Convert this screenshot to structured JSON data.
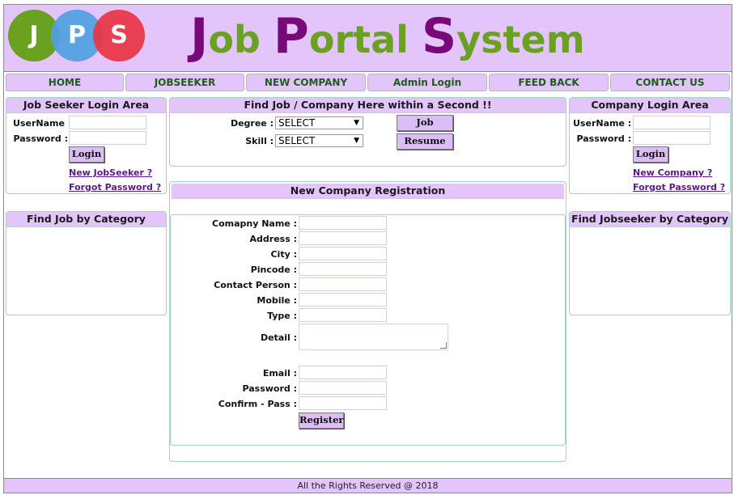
{
  "header": {
    "logo_letters": [
      "J",
      "P",
      "S"
    ],
    "title_parts": [
      {
        "text": "J",
        "size": "big"
      },
      {
        "text": "ob ",
        "size": "small"
      },
      {
        "text": "P",
        "size": "big"
      },
      {
        "text": "ortal ",
        "size": "small"
      },
      {
        "text": "S",
        "size": "big"
      },
      {
        "text": "ystem",
        "size": "small"
      }
    ]
  },
  "nav": {
    "items": [
      "HOME",
      "JOBSEEKER",
      "NEW COMPANY",
      "Admin Login",
      "FEED BACK",
      "CONTACT US"
    ]
  },
  "jobseeker_login": {
    "title": "Job Seeker Login Area",
    "username_label": "UserName :",
    "password_label": "Password :",
    "login_button": "Login",
    "new_link": "New JobSeeker ?",
    "forgot_link": "Forgot Password ?"
  },
  "find_job_category": {
    "title": "Find Job by Category"
  },
  "search": {
    "title": "Find Job / Company Here within a Second !!",
    "degree_label": "Degree :",
    "degree_value": "SELECT",
    "skill_label": "Skill :",
    "skill_value": "SELECT",
    "job_button": "Job",
    "resume_button": "Resume"
  },
  "registration": {
    "title": "New Company Registration",
    "labels": {
      "company_name": "Comapny Name :",
      "address": "Address :",
      "city": "City :",
      "pincode": "Pincode :",
      "contact_person": "Contact Person :",
      "mobile": "Mobile :",
      "type": "Type :",
      "detail": "Detail  :",
      "email": "Email :",
      "password": "Password :",
      "confirm_pass": "Confirm - Pass :"
    },
    "register_button": "Register"
  },
  "company_login": {
    "title": "Company Login Area",
    "username_label": "UserName :",
    "password_label": "Password :",
    "login_button": "Login",
    "new_link": "New Company ?",
    "forgot_link": "Forgot Password ?"
  },
  "find_jobseeker_category": {
    "title": "Find Jobseeker by Category"
  },
  "footer": {
    "text": "All the Rights Reserved @ 2018"
  },
  "colors": {
    "header_bg": "#e3c5fb",
    "title_big": "#780978",
    "title_small": "#6aa121",
    "logo_green": "#6aa121",
    "logo_blue": "#50a0e1",
    "logo_red": "#e83545",
    "nav_text": "#1f5a1f",
    "link": "#5a1a8a",
    "panel_border": "#9fd5c2"
  }
}
